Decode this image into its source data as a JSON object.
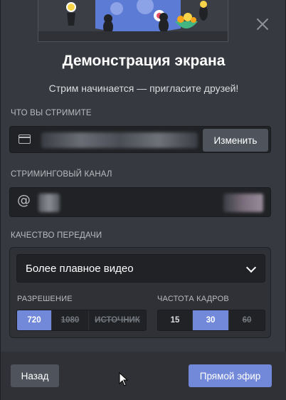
{
  "modal": {
    "title": "Демонстрация экрана",
    "subtitle": "Стрим начинается — пригласите друзей!",
    "close_icon": "close-icon"
  },
  "stream_source": {
    "label": "ЧТО ВЫ СТРИМИТЕ",
    "icon": "app-window-icon",
    "change_label": "Изменить"
  },
  "stream_channel": {
    "label": "СТРИМИНГОВЫЙ КАНАЛ",
    "icon": "at-sign-icon"
  },
  "quality": {
    "label": "КАЧЕСТВО ПЕРЕДАЧИ",
    "preset": "Более плавное видео",
    "resolution": {
      "label": "РАЗРЕШЕНИЕ",
      "options": [
        "720",
        "1080",
        "ИСТОЧНИК"
      ],
      "selected": "720"
    },
    "framerate": {
      "label": "ЧАСТОТА КАДРОВ",
      "options": [
        "15",
        "30",
        "60"
      ],
      "selected": "30"
    }
  },
  "footer": {
    "back_label": "Назад",
    "go_live_label": "Прямой эфир"
  },
  "colors": {
    "accent": "#7289da",
    "background": "#36393f",
    "field": "#202225"
  }
}
